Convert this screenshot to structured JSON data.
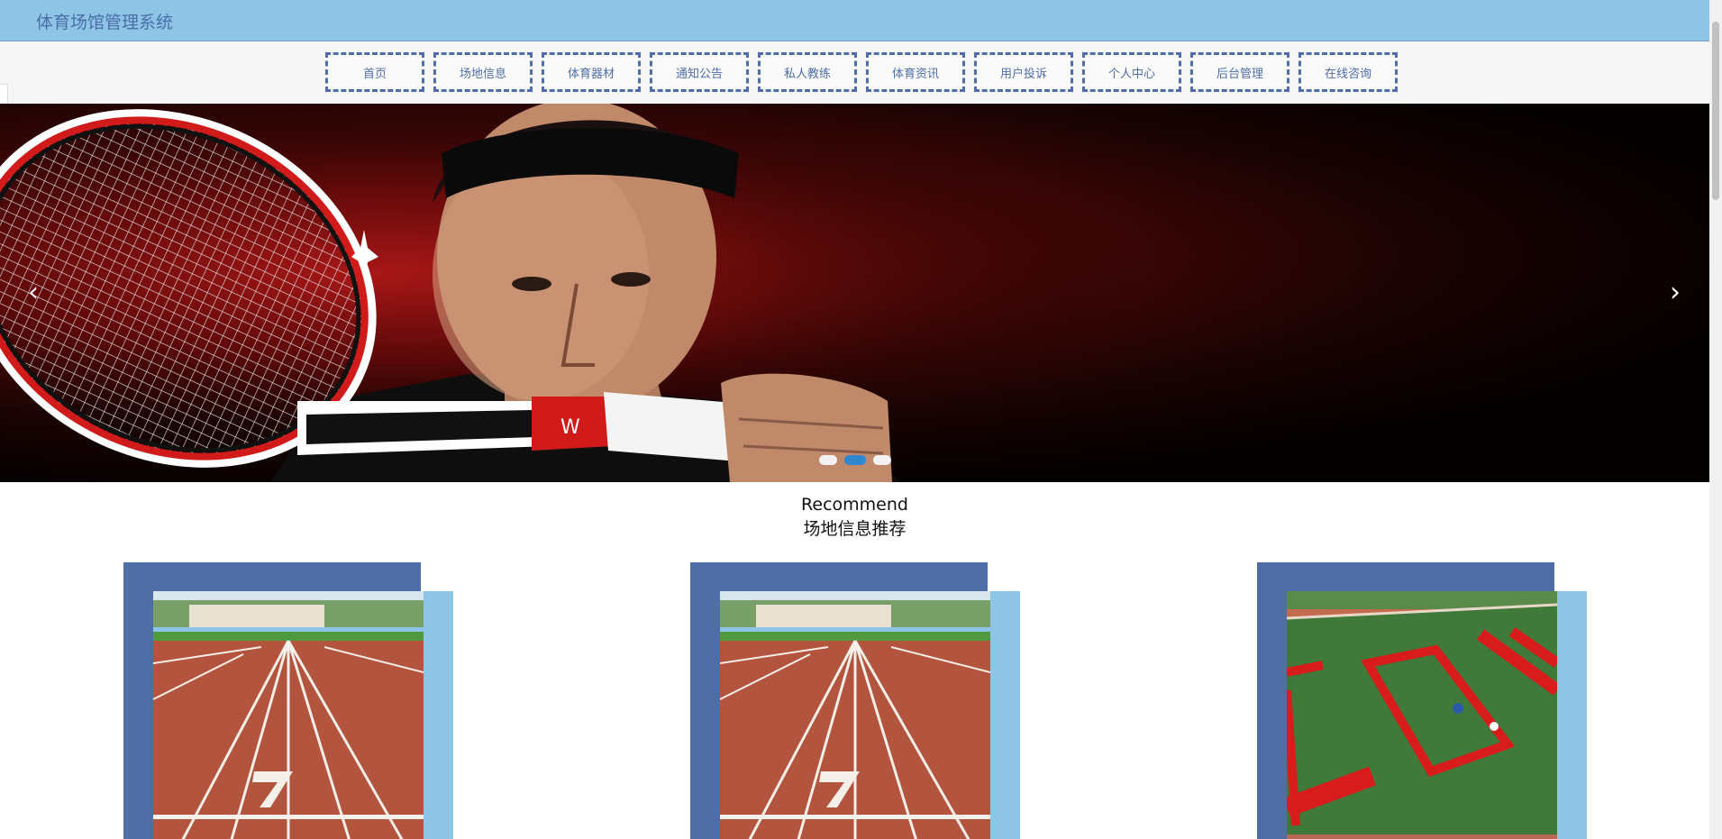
{
  "header": {
    "title": "体育场馆管理系统"
  },
  "nav": {
    "items": [
      {
        "label": "首页"
      },
      {
        "label": "场地信息"
      },
      {
        "label": "体育器材"
      },
      {
        "label": "通知公告"
      },
      {
        "label": "私人教练"
      },
      {
        "label": "体育资讯"
      },
      {
        "label": "用户投诉"
      },
      {
        "label": "个人中心"
      },
      {
        "label": "后台管理"
      },
      {
        "label": "在线咨询"
      }
    ]
  },
  "carousel": {
    "prev_icon": "chevron-left-icon",
    "next_icon": "chevron-right-icon",
    "prev_glyph": "‹",
    "next_glyph": "›",
    "slide_count": 3,
    "active_index": 1,
    "racket_brand": "W"
  },
  "recommend": {
    "title_en": "Recommend",
    "title_cn": "场地信息推荐",
    "cards": [
      {
        "image": "running-track-lane-7"
      },
      {
        "image": "running-track-lane-7"
      },
      {
        "image": "sports-field-aerial-red-tents"
      }
    ]
  },
  "colors": {
    "topbar": "#8ec5e6",
    "primary": "#4f6ea6",
    "accent_light": "#8ec5e6",
    "dot_active": "#2f86d1"
  }
}
